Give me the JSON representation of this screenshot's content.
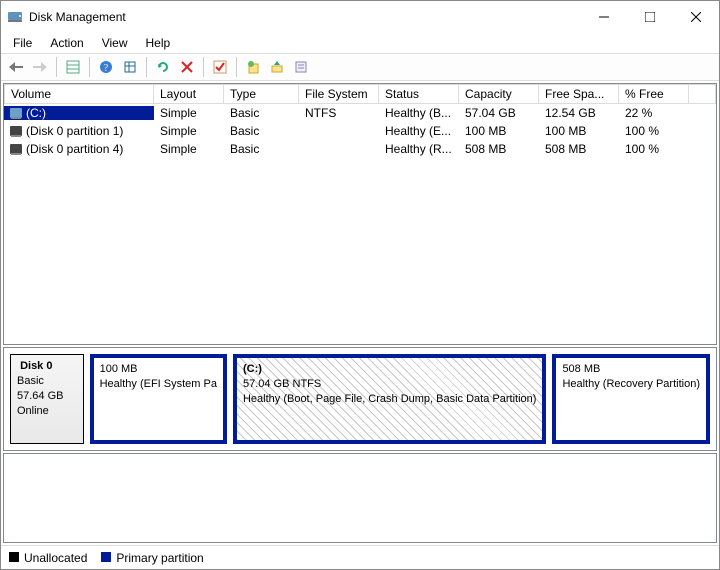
{
  "window": {
    "title": "Disk Management"
  },
  "menu": {
    "file": "File",
    "action": "Action",
    "view": "View",
    "help": "Help"
  },
  "columns": [
    "Volume",
    "Layout",
    "Type",
    "File System",
    "Status",
    "Capacity",
    "Free Spa...",
    "% Free"
  ],
  "volumes": [
    {
      "icon": "drive",
      "name": "(C:)",
      "layout": "Simple",
      "type": "Basic",
      "fs": "NTFS",
      "status": "Healthy (B...",
      "capacity": "57.04 GB",
      "free": "12.54 GB",
      "pct": "22 %",
      "selected": true
    },
    {
      "icon": "drive-dark",
      "name": "(Disk 0 partition 1)",
      "layout": "Simple",
      "type": "Basic",
      "fs": "",
      "status": "Healthy (E...",
      "capacity": "100 MB",
      "free": "100 MB",
      "pct": "100 %",
      "selected": false
    },
    {
      "icon": "drive-dark",
      "name": "(Disk 0 partition 4)",
      "layout": "Simple",
      "type": "Basic",
      "fs": "",
      "status": "Healthy (R...",
      "capacity": "508 MB",
      "free": "508 MB",
      "pct": "100 %",
      "selected": false
    }
  ],
  "disk": {
    "icon": "drive-dark",
    "name": "Disk 0",
    "type": "Basic",
    "size": "57.64 GB",
    "state": "Online"
  },
  "partitions": [
    {
      "title": "",
      "line1": "100 MB",
      "line2": "Healthy (EFI System Pa",
      "flex": 0.18,
      "selected": false
    },
    {
      "title": "(C:)",
      "line1": "57.04 GB NTFS",
      "line2": "Healthy (Boot, Page File, Crash Dump, Basic Data Partition)",
      "flex": 0.55,
      "selected": true
    },
    {
      "title": "",
      "line1": "508 MB",
      "line2": "Healthy (Recovery Partition)",
      "flex": 0.27,
      "selected": false
    }
  ],
  "legend": {
    "unalloc": "Unallocated",
    "primary": "Primary partition"
  },
  "colors": {
    "primary": "#001c98",
    "unalloc": "#000000"
  }
}
